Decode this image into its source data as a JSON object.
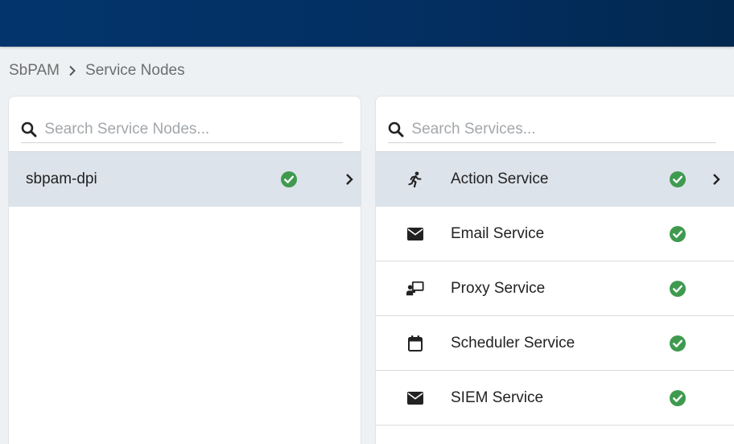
{
  "breadcrumb": {
    "root": "SbPAM",
    "current": "Service Nodes"
  },
  "nodes_panel": {
    "search_placeholder": "Search Service Nodes...",
    "items": [
      {
        "label": "sbpam-dpi",
        "status": "ok",
        "selected": true
      }
    ]
  },
  "services_panel": {
    "search_placeholder": "Search Services...",
    "items": [
      {
        "label": "Action Service",
        "icon": "running-person-icon",
        "status": "ok",
        "selected": true
      },
      {
        "label": "Email Service",
        "icon": "envelope-icon",
        "status": "ok",
        "selected": false
      },
      {
        "label": "Proxy Service",
        "icon": "presenter-screen-icon",
        "status": "ok",
        "selected": false
      },
      {
        "label": "Scheduler Service",
        "icon": "calendar-icon",
        "status": "ok",
        "selected": false
      },
      {
        "label": "SIEM Service",
        "icon": "envelope-icon",
        "status": "ok",
        "selected": false
      }
    ]
  },
  "colors": {
    "header": "#03356c",
    "status_ok": "#3f9a4f",
    "selected_row": "#dde3ea"
  }
}
